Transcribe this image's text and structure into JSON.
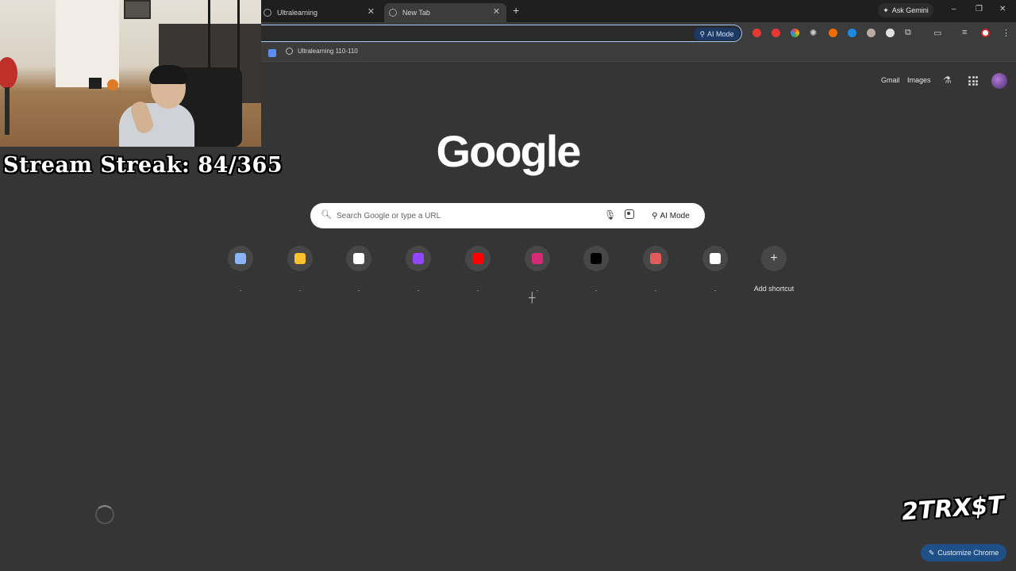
{
  "browser": {
    "tabs": [
      {
        "title": "Ultralearning"
      },
      {
        "title": "New Tab"
      }
    ],
    "new_tab_symbol": "+",
    "ask_gemini": "Ask Gemini",
    "omnibox_ai_mode": "AI Mode",
    "bookmarks": [
      {
        "label": "Ultralearning 110-110"
      }
    ],
    "window_controls": {
      "minimize": "–",
      "restore": "❐",
      "close": "✕"
    },
    "extension_colors": [
      "#e53935",
      "#e53935",
      "#4caf50",
      "#9aa0a6",
      "#ef6c00",
      "#1e88e5",
      "#bcaaa4",
      "#e0e0e0"
    ]
  },
  "overlay": {
    "stream_streak": "Stream Streak: 84/365",
    "watermark": "2TRX$T"
  },
  "ntp": {
    "header_links": {
      "gmail": "Gmail",
      "images": "Images"
    },
    "logo": "Google",
    "search": {
      "placeholder": "Search Google or type a URL",
      "ai_mode": "AI Mode"
    },
    "shortcuts": [
      {
        "icon": "gemini-icon",
        "label": ".",
        "color": "#8ab4f8"
      },
      {
        "icon": "google-classroom-icon",
        "label": ".",
        "color": "#fbc02d"
      },
      {
        "icon": "chatgpt-icon",
        "label": ".",
        "color": "#ffffff"
      },
      {
        "icon": "twitch-icon",
        "label": ".",
        "color": "#9146ff"
      },
      {
        "icon": "youtube-icon",
        "label": ".",
        "color": "#ff0000"
      },
      {
        "icon": "instagram-icon",
        "label": ".",
        "color": "#d62976"
      },
      {
        "icon": "tiktok-icon",
        "label": ".",
        "color": "#000000"
      },
      {
        "icon": "photos-icon",
        "label": ".",
        "color": "#e25a5a"
      },
      {
        "icon": "amazon-icon",
        "label": ".",
        "color": "#ffffff"
      }
    ],
    "add_shortcut": "Add shortcut",
    "customize_chrome": "Customize Chrome"
  }
}
